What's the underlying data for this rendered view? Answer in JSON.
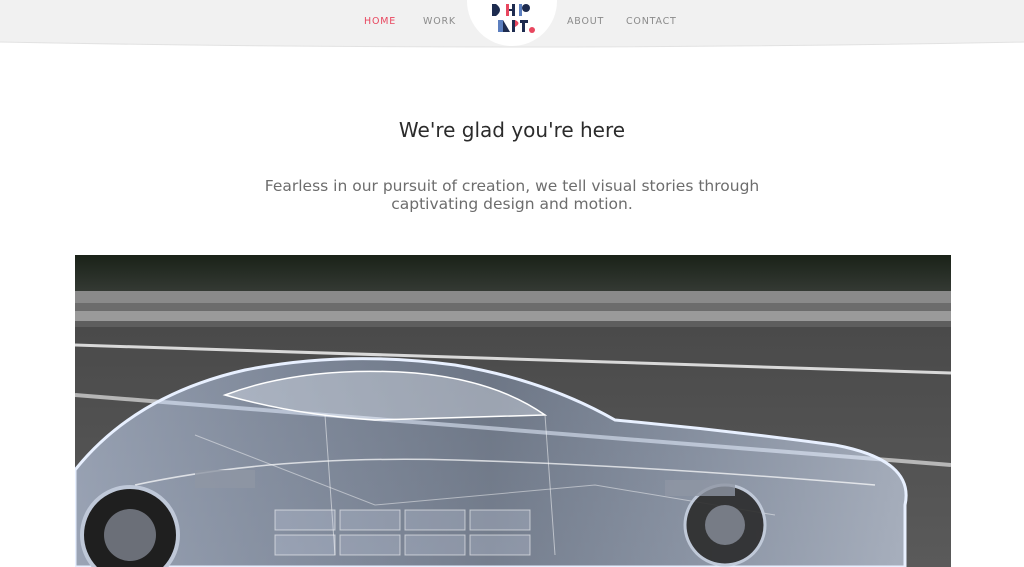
{
  "nav": {
    "home": "HOME",
    "work": "WORK",
    "about": "ABOUT",
    "contact": "CONTACT",
    "active_color": "#e8475f",
    "inactive_color": "#8b8b8b"
  },
  "logo": {
    "icon": "dhp-logo-icon"
  },
  "hero": {
    "title": "We're glad you're here",
    "subtitle_line1": "Fearless in our pursuit of creation, we tell visual stories through",
    "subtitle_line2": "captivating design and motion."
  },
  "media": {
    "subject": "transparent x-ray sports car on highway"
  }
}
